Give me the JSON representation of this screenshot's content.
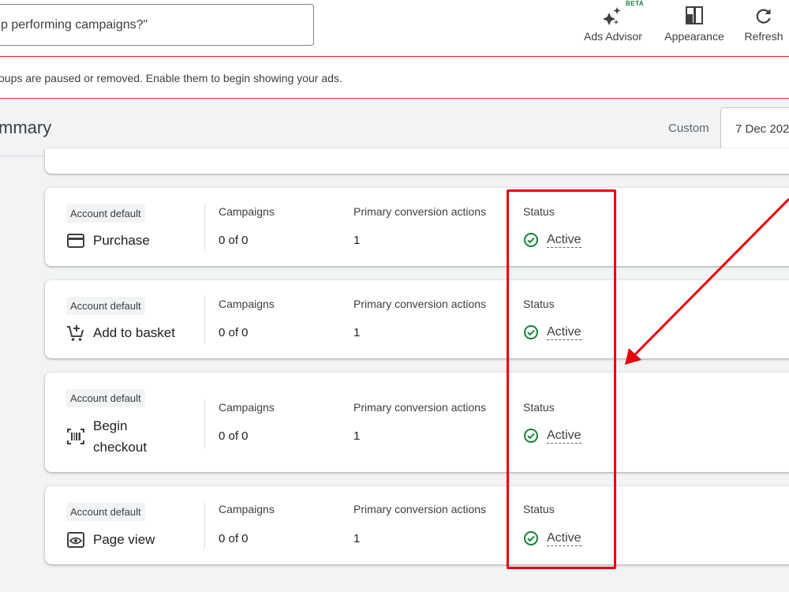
{
  "toolbar": {
    "search_text": "p performing campaigns?\"",
    "beta_badge": "BETA",
    "ads_advisor": "Ads Advisor",
    "appearance": "Appearance",
    "refresh": "Refresh"
  },
  "banner": {
    "message": "oups are paused or removed. Enable them to begin showing your ads."
  },
  "summary": {
    "title": "mmary",
    "range_label": "Custom",
    "date_value": "7 Dec 202"
  },
  "goals": [
    {
      "chip": "Account default",
      "name": "Purchase",
      "icon": "credit-card-icon",
      "campaigns_header": "Campaigns",
      "campaigns": "0 of 0",
      "actions_header": "Primary conversion actions",
      "actions": "1",
      "status_header": "Status",
      "status": "Active"
    },
    {
      "chip": "Account default",
      "name": "Add to basket",
      "icon": "add-to-cart-icon",
      "campaigns_header": "Campaigns",
      "campaigns": "0 of 0",
      "actions_header": "Primary conversion actions",
      "actions": "1",
      "status_header": "Status",
      "status": "Active"
    },
    {
      "chip": "Account default",
      "name_line1": "Begin",
      "name_line2": "checkout",
      "icon": "barcode-scan-icon",
      "campaigns_header": "Campaigns",
      "campaigns": "0 of 0",
      "actions_header": "Primary conversion actions",
      "actions": "1",
      "status_header": "Status",
      "status": "Active"
    },
    {
      "chip": "Account default",
      "name": "Page view",
      "icon": "page-view-eye-icon",
      "campaigns_header": "Campaigns",
      "campaigns": "0 of 0",
      "actions_header": "Primary conversion actions",
      "actions": "1",
      "status_header": "Status",
      "status": "Active"
    }
  ],
  "colors": {
    "annotation_red": "#e8000b",
    "active_green": "#188038",
    "error_border": "#d93025"
  }
}
